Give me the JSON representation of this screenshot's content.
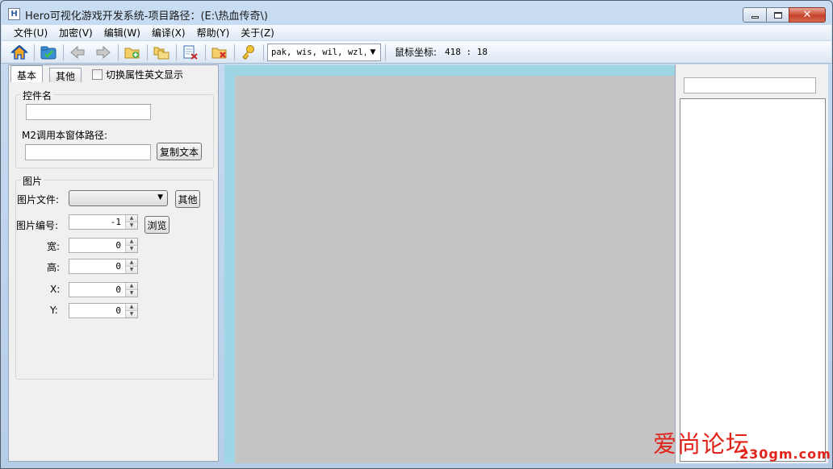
{
  "window": {
    "title": "Hero可视化游戏开发系统-项目路径：(E:\\热血传奇\\)",
    "app_icon": "H"
  },
  "menu": [
    {
      "label": "文件(U)"
    },
    {
      "label": "加密(V)"
    },
    {
      "label": "编辑(W)"
    },
    {
      "label": "编译(X)"
    },
    {
      "label": "帮助(Y)"
    },
    {
      "label": "关于(Z)"
    }
  ],
  "toolbar": {
    "icons": [
      "home-icon",
      "open-folder-icon",
      "back-arrow-icon",
      "forward-arrow-icon",
      "new-folder-icon",
      "copy-folder-icon",
      "cut-icon",
      "delete-folder-icon",
      "key-icon"
    ],
    "format_combo_value": "pak, wis, wil, wzl,",
    "mouse_label": "鼠标坐标:",
    "mouse_value": "418 : 18"
  },
  "left_panel": {
    "tabs": [
      "基本",
      "其他"
    ],
    "toggle_english_label": "切换属性英文显示",
    "control_group": {
      "title": "控件名",
      "control_name_value": "",
      "m2_label": "M2调用本窗体路径:",
      "m2_path_value": "",
      "copy_button": "复制文本"
    },
    "image_group": {
      "title": "图片",
      "file_label": "图片文件:",
      "file_value": "",
      "other_button": "其他",
      "index_label": "图片编号:",
      "index_value": "-1",
      "browse_button": "浏览",
      "width_label": "宽:",
      "width_value": "0",
      "height_label": "高:",
      "height_value": "0",
      "x_label": "X:",
      "x_value": "0",
      "y_label": "Y:",
      "y_value": "0"
    }
  },
  "right_panel": {
    "input_value": ""
  },
  "watermark": {
    "text": "爱尚论坛",
    "url": "230gm.com"
  },
  "colors": {
    "canvas_border": "#9fd6e6",
    "canvas": "#c4c4c4",
    "close_button": "#c7422b",
    "watermark": "#e2231a"
  }
}
